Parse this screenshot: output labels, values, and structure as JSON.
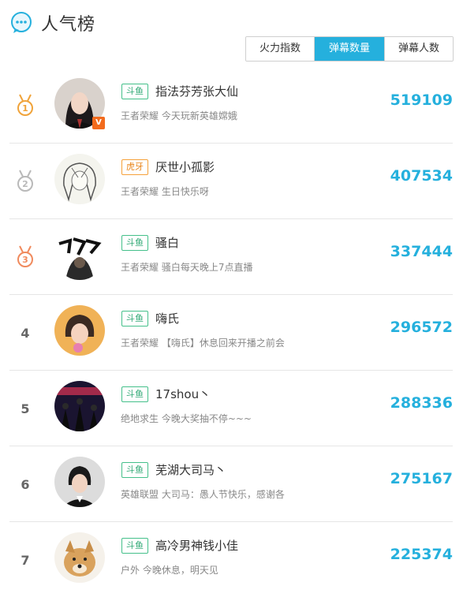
{
  "header": {
    "title": "人气榜"
  },
  "tabs": [
    {
      "label": "火力指数",
      "active": false
    },
    {
      "label": "弹幕数量",
      "active": true
    },
    {
      "label": "弹幕人数",
      "active": false
    }
  ],
  "rows": [
    {
      "rank": "1",
      "medal": "gold",
      "platform": "斗鱼",
      "name": "指法芬芳张大仙",
      "desc": "王者荣耀 今天玩新英雄嫦娥",
      "score": "519109",
      "badge": "V"
    },
    {
      "rank": "2",
      "medal": "silver",
      "platform": "虎牙",
      "name": "厌世小孤影",
      "desc": "王者荣耀 生日快乐呀",
      "score": "407534"
    },
    {
      "rank": "3",
      "medal": "bronze",
      "platform": "斗鱼",
      "name": "骚白",
      "desc": "王者荣耀 骚白每天晚上7点直播",
      "score": "337444"
    },
    {
      "rank": "4",
      "platform": "斗鱼",
      "name": "嗨氏",
      "desc": "王者荣耀 【嗨氏】休息回来开播之前会",
      "score": "296572"
    },
    {
      "rank": "5",
      "platform": "斗鱼",
      "name": "17shou丶",
      "desc": "绝地求生 今晚大奖抽不停~~~",
      "score": "288336"
    },
    {
      "rank": "6",
      "platform": "斗鱼",
      "name": "芜湖大司马丶",
      "desc": "英雄联盟 大司马：愚人节快乐，感谢各",
      "score": "275167"
    },
    {
      "rank": "7",
      "platform": "斗鱼",
      "name": "高冷男神钱小佳",
      "desc": "户外 今晚休息，明天见",
      "score": "225374"
    }
  ],
  "colors": {
    "accent": "#25b0dd",
    "douyu": "#2ea874",
    "huya": "#e9861a",
    "gold": "#f0a33a",
    "silver": "#b9b9b9",
    "bronze": "#f08a5d"
  }
}
